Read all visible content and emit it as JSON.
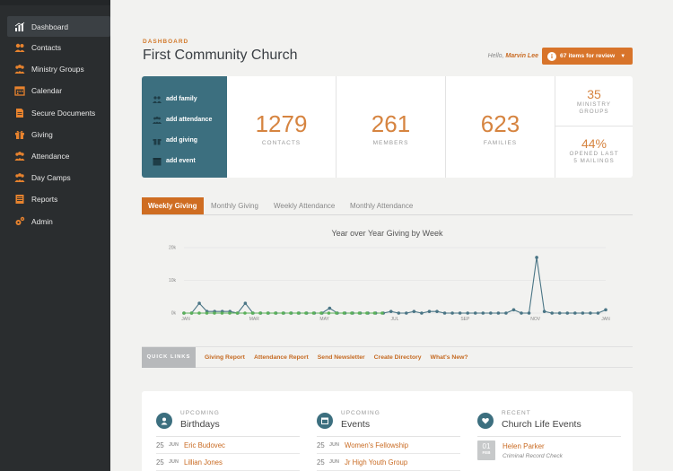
{
  "sidebar": {
    "items": [
      {
        "label": "Dashboard",
        "icon": "chart-icon"
      },
      {
        "label": "Contacts",
        "icon": "people-icon"
      },
      {
        "label": "Ministry Groups",
        "icon": "group-icon"
      },
      {
        "label": "Calendar",
        "icon": "calendar-icon"
      },
      {
        "label": "Secure Documents",
        "icon": "document-icon"
      },
      {
        "label": "Giving",
        "icon": "gift-icon"
      },
      {
        "label": "Attendance",
        "icon": "attendance-icon"
      },
      {
        "label": "Day Camps",
        "icon": "camp-icon"
      },
      {
        "label": "Reports",
        "icon": "report-icon"
      },
      {
        "label": "Admin",
        "icon": "gears-icon"
      }
    ]
  },
  "header": {
    "kicker": "DASHBOARD",
    "title": "First Community Church",
    "hello_prefix": "Hello,",
    "user": "Marvin Lee",
    "review_label": "67 items for review"
  },
  "actions": [
    "add family",
    "add attendance",
    "add giving",
    "add event"
  ],
  "stats": [
    {
      "value": "1279",
      "label": "CONTACTS"
    },
    {
      "value": "261",
      "label": "MEMBERS"
    },
    {
      "value": "623",
      "label": "FAMILIES"
    }
  ],
  "mini_stats": [
    {
      "value": "35",
      "label1": "MINISTRY",
      "label2": "GROUPS"
    },
    {
      "value": "44%",
      "label1": "OPENED LAST",
      "label2": "5 MAILINGS"
    }
  ],
  "tabs": [
    "Weekly Giving",
    "Monthly Giving",
    "Weekly Attendance",
    "Monthly Attendance"
  ],
  "chart_data": {
    "type": "line",
    "title": "Year over Year Giving by Week",
    "x_labels": [
      "JAN",
      "MAR",
      "MAY",
      "JUL",
      "SEP",
      "NOV",
      "JAN"
    ],
    "y_ticks": [
      "20k",
      "10k",
      "0k"
    ],
    "ylim": [
      0,
      20000
    ],
    "series": [
      {
        "color": "#4a7585",
        "values": [
          0,
          0,
          3000,
          500,
          500,
          500,
          500,
          0,
          3000,
          0,
          0,
          0,
          0,
          0,
          0,
          0,
          0,
          0,
          0,
          1500,
          0,
          0,
          0,
          0,
          0,
          0,
          0,
          500,
          0,
          0,
          500,
          0,
          500,
          500,
          0,
          0,
          0,
          0,
          0,
          0,
          0,
          0,
          0,
          1000,
          0,
          0,
          17000,
          500,
          0,
          0,
          0,
          0,
          0,
          0,
          0,
          1000
        ]
      },
      {
        "color": "#5bb05a",
        "values": [
          0,
          0,
          0,
          0,
          0,
          0,
          0,
          0,
          0,
          0,
          0,
          0,
          0,
          0,
          0,
          0,
          0,
          0,
          0,
          0,
          0,
          0,
          0,
          0,
          0,
          0,
          0
        ]
      }
    ]
  },
  "quick_links": {
    "label": "QUICK LINKS",
    "links": [
      "Giving Report",
      "Attendance Report",
      "Send Newsletter",
      "Create Directory",
      "What's New?"
    ]
  },
  "birthdays": {
    "kicker": "UPCOMING",
    "title": "Birthdays",
    "rows": [
      {
        "day": "25",
        "month": "JUN",
        "name": "Eric Budovec"
      },
      {
        "day": "25",
        "month": "JUN",
        "name": "Lillian Jones"
      }
    ]
  },
  "events": {
    "kicker": "UPCOMING",
    "title": "Events",
    "rows": [
      {
        "day": "25",
        "month": "JUN",
        "name": "Women's Fellowship"
      },
      {
        "day": "25",
        "month": "JUN",
        "name": "Jr High Youth Group"
      }
    ]
  },
  "life_events": {
    "kicker": "RECENT",
    "title": "Church Life Events",
    "items": [
      {
        "day": "01",
        "month": "FEB",
        "name": "Helen Parker",
        "sub": "Criminal Record Check"
      }
    ]
  }
}
